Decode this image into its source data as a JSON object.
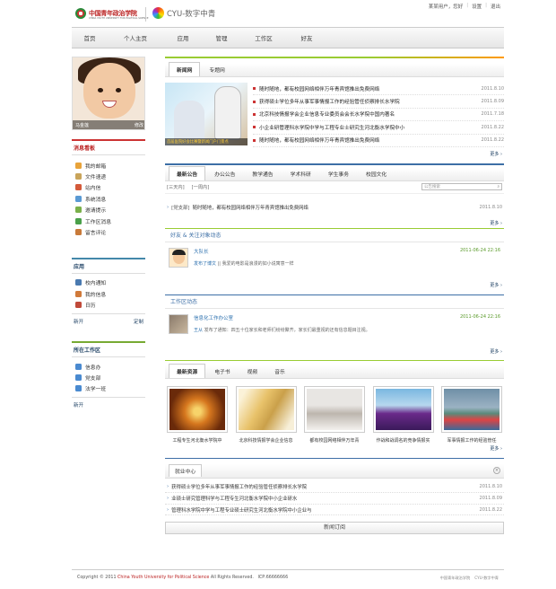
{
  "header": {
    "logo_name": "中国青年政治学院",
    "logo_sub": "CHINA YOUTH UNIVERSITY FOR POLITICAL SCIENCE",
    "portal_name": "CYU-数字中青",
    "user_text": "某某用户，您好",
    "settings_link": "设置",
    "logout_link": "退出"
  },
  "nav": [
    "首页",
    "个人主页",
    "应用",
    "管理",
    "工作区",
    "好友"
  ],
  "profile": {
    "name": "马金莲",
    "change_label": "修改"
  },
  "messages": {
    "title": "消息看板",
    "items": [
      "我的邮箱",
      "文件速递",
      "站内信",
      "系统消息",
      "邀请提示",
      "工作区消息",
      "留言评论"
    ]
  },
  "apps": {
    "title": "应用",
    "items": [
      "校内通知",
      "我的信息",
      "日历"
    ],
    "new_link": "新开",
    "custom_link": "定制"
  },
  "workspace": {
    "title": "所在工作区",
    "items": [
      "信息办",
      "党支部",
      "法学一班"
    ],
    "new_link": "新开"
  },
  "news": {
    "tabs": [
      "新闻网",
      "专题网"
    ],
    "photo_caption": "首届医院好会比赛暨新闻门户门景点",
    "items": [
      {
        "title": "随时随地，都有校园网络相伴万年青宾馆推出免费网络",
        "date": "2011.8.10"
      },
      {
        "title": "获得硕士学位多年从事军事情报工作的经验管任侦察排长水学院",
        "date": "2011.8.09"
      },
      {
        "title": "北京科技情报学会企业信息专业委员会会长水学院中国内著名",
        "date": "2011.7.18"
      },
      {
        "title": "小企业研管理科水学院中学与工程专业士研究生河北衡水学院中小",
        "date": "2011.8.22"
      },
      {
        "title": "随时随地，都有校园网络相伴万年青宾馆推出免费网络",
        "date": "2011.8.22"
      }
    ],
    "more": "更多 ›"
  },
  "notices": {
    "tabs": [
      "最新公告",
      "办公公告",
      "教学通告",
      "学术科研",
      "学生事务",
      "校园文化"
    ],
    "filter_3days": "[三天内]",
    "filter_week": "[一周内]",
    "search_placeholder": "公告搜索",
    "items": [
      {
        "tag": "[党支部]",
        "title": "随时随地，都有校园网络相伴万年青宾馆推出免费网络",
        "date": "2011.8.10"
      }
    ],
    "more": "更多 ›"
  },
  "friends": {
    "title": "好友 & 关注对象动态",
    "name": "大队长",
    "time": "2011-06-24 22:16",
    "action": "发布了博文",
    "text": "|| 我爱的电影是浪漫的如小说寓意一样",
    "more": "更多 ›"
  },
  "workzone": {
    "title": "工作区动态",
    "name": "信息化工作办公室",
    "time": "2011-06-24 22:16",
    "user": "王从",
    "text": "发布了通知：四五十位家长和老师们纷纷聚齐，家长们最重视的还有信息题目注视。",
    "more": "更多 ›"
  },
  "resources": {
    "tabs": [
      "最新资源",
      "电子书",
      "视频",
      "音乐"
    ],
    "items": [
      "工程专生河北衡水学院中",
      "北京科技情报学会企业信息",
      "都有校园网络相伴万年青",
      "作战和战调名的竞争情报实",
      "军事情报工作的经验管任"
    ],
    "more": "更多 ›"
  },
  "jobs": {
    "title": "就业中心",
    "close_label": "×",
    "items": [
      {
        "title": "获得硕士学位多年从事军事情报工作的经验管任侦察排长水学院",
        "date": "2011.8.10"
      },
      {
        "title": "业硕士研究管理科学与工程专生河北衡水学院中小企业研水",
        "date": "2011.8.09"
      },
      {
        "title": "管理科水学院中学与工程专业硕士研究生河北衡水学院中小企业与",
        "date": "2011.8.22"
      }
    ]
  },
  "subscribe_label": "新闻订阅",
  "footer": {
    "copyright_prefix": "Copyright © 2011",
    "school": "China Youth University for Political Science",
    "rights": "All Rights Reserved.",
    "icp": "ICP:66666666",
    "logo1": "中国青年政治学院",
    "logo2": "CYU-数字中青"
  }
}
